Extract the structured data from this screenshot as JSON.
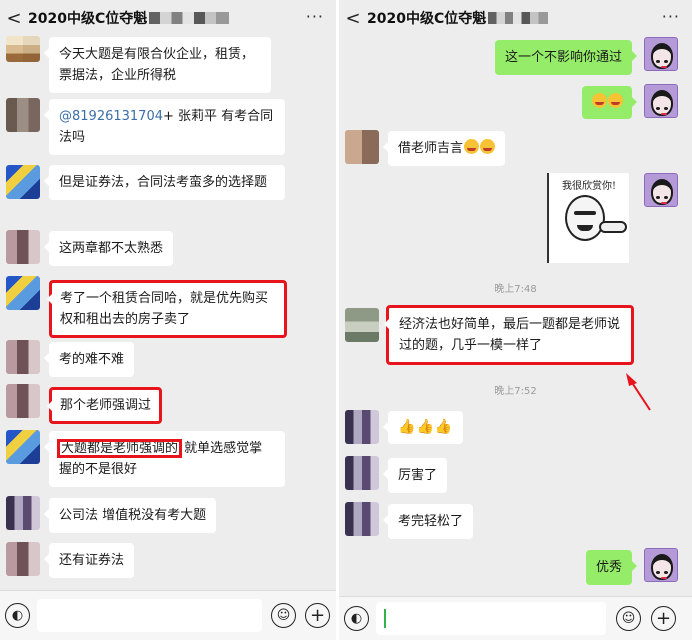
{
  "left": {
    "header": {
      "back": "<",
      "title": "2020中级C位夺魁",
      "more": "···"
    },
    "messages": [
      {
        "text": "今天大题是有限合伙企业，租赁，票据法，企业所得税"
      },
      {
        "mention": "@81926131704",
        "text": "+ 张莉平  有考合同法吗"
      },
      {
        "text": "但是证券法，合同法考蛮多的选择题"
      },
      {
        "text": "这两章都不太熟悉"
      },
      {
        "text": "考了一个租赁合同哈，就是优先购买权和租出去的房子卖了"
      },
      {
        "text": "考的难不难"
      },
      {
        "text": "那个老师强调过"
      },
      {
        "highlight": "大题都是老师强调的",
        "text": "就单选感觉掌握的不是很好"
      },
      {
        "text": "公司法 增值税没有考大题"
      },
      {
        "text": "还有证券法"
      }
    ]
  },
  "right": {
    "header": {
      "back": "<",
      "title": "2020中级C位夺魁",
      "title_tail": "...",
      "more": "···"
    },
    "messages": [
      {
        "text": "这一个不影响你通过"
      },
      {
        "emoji": "[grin][grin]"
      },
      {
        "text": "借老师吉言"
      },
      {
        "sticker_text": "我很欣赏你!"
      },
      {
        "timestamp": "晚上7:48"
      },
      {
        "text": "经济法也好简单，最后一题都是老师说过的题，几乎一模一样了"
      },
      {
        "timestamp": "晚上7:52"
      },
      {
        "emoji": "[thumbs-up][thumbs-up][thumbs-up]"
      },
      {
        "text": "厉害了"
      },
      {
        "text": "考完轻松了"
      },
      {
        "text": "优秀"
      }
    ]
  },
  "colors": {
    "accent_red": "#e8141c",
    "bubble_green": "#95ec69",
    "bg": "#ededed"
  },
  "icons": [
    "back-icon",
    "more-icon",
    "voice-icon",
    "emoji-icon",
    "plus-icon"
  ]
}
